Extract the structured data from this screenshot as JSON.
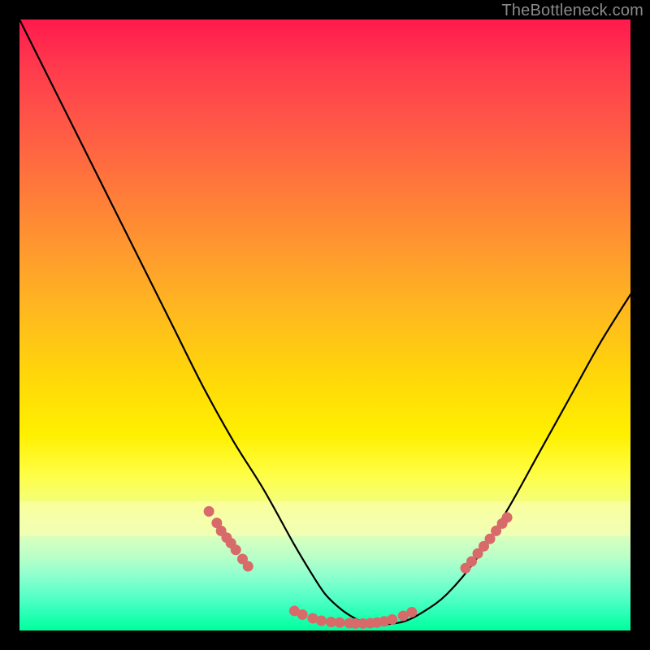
{
  "watermark": "TheBottleneck.com",
  "colors": {
    "page_bg": "#000000",
    "curve": "#000000",
    "marker": "#d86a6a",
    "pale_band": "#ffffb0"
  },
  "chart_data": {
    "type": "line",
    "title": "",
    "xlabel": "",
    "ylabel": "",
    "x_range": [
      0,
      100
    ],
    "y_range": [
      0,
      100
    ],
    "grid": false,
    "legend": false,
    "series": [
      {
        "name": "bottleneck-curve",
        "x": [
          0,
          5,
          10,
          15,
          20,
          25,
          30,
          35,
          40,
          45,
          48,
          50,
          52,
          54,
          56,
          58,
          60,
          63,
          66,
          70,
          75,
          80,
          85,
          90,
          95,
          100
        ],
        "y": [
          100,
          90,
          80,
          70,
          60,
          50,
          40,
          31,
          23,
          14,
          9,
          6,
          4,
          2.5,
          1.5,
          1,
          1,
          1.5,
          3,
          6,
          12,
          20,
          29,
          38,
          47,
          55
        ]
      }
    ],
    "marker_clusters": [
      {
        "name": "left-descent-markers",
        "points": [
          [
            31.0,
            19.5
          ],
          [
            32.3,
            17.6
          ],
          [
            33.0,
            16.3
          ],
          [
            33.9,
            15.2
          ],
          [
            34.6,
            14.3
          ],
          [
            35.4,
            13.2
          ],
          [
            36.5,
            11.7
          ],
          [
            37.4,
            10.5
          ]
        ]
      },
      {
        "name": "valley-markers",
        "points": [
          [
            45.0,
            3.2
          ],
          [
            46.3,
            2.6
          ],
          [
            48.0,
            2.0
          ],
          [
            49.4,
            1.6
          ],
          [
            51.0,
            1.4
          ],
          [
            52.4,
            1.3
          ],
          [
            54.0,
            1.2
          ],
          [
            55.0,
            1.15
          ],
          [
            56.2,
            1.15
          ],
          [
            57.4,
            1.2
          ],
          [
            58.5,
            1.3
          ],
          [
            59.7,
            1.5
          ],
          [
            61.0,
            1.8
          ],
          [
            62.8,
            2.4
          ],
          [
            64.2,
            3.0
          ]
        ]
      },
      {
        "name": "right-ascent-markers",
        "points": [
          [
            73.0,
            10.2
          ],
          [
            74.0,
            11.3
          ],
          [
            75.0,
            12.6
          ],
          [
            76.0,
            13.8
          ],
          [
            77.0,
            15.0
          ],
          [
            78.0,
            16.3
          ],
          [
            79.0,
            17.5
          ],
          [
            79.8,
            18.5
          ]
        ]
      }
    ],
    "pale_band_y": [
      15.4,
      21.2
    ]
  }
}
